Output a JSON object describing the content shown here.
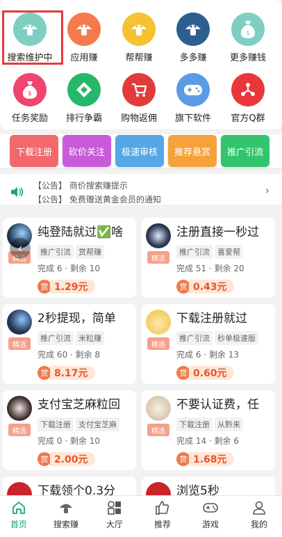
{
  "grid": [
    {
      "label": "搜索维护中",
      "color": "#7ecfc1",
      "icon": "mushroom-icon"
    },
    {
      "label": "应用赚",
      "color": "#f57b4e",
      "icon": "mushroom-icon"
    },
    {
      "label": "帮帮赚",
      "color": "#f6c233",
      "icon": "mushroom-icon"
    },
    {
      "label": "多多赚",
      "color": "#2e5e8f",
      "icon": "mushroom-icon"
    },
    {
      "label": "更多赚钱",
      "color": "#7ecfc1",
      "icon": "money-bag-icon"
    },
    {
      "label": "任务奖励",
      "color": "#f0456e",
      "icon": "money-bag-icon"
    },
    {
      "label": "排行争霸",
      "color": "#25b86a",
      "icon": "diamond-icon"
    },
    {
      "label": "购物返佣",
      "color": "#e23b3b",
      "icon": "cart-icon"
    },
    {
      "label": "旗下软件",
      "color": "#5b9be6",
      "icon": "gamepad-icon"
    },
    {
      "label": "官方Q群",
      "color": "#e9363a",
      "icon": "share-icon"
    }
  ],
  "buttons": [
    {
      "label": "下载注册",
      "color": "#f2686b"
    },
    {
      "label": "砍价关注",
      "color": "#c85bd8"
    },
    {
      "label": "极速审核",
      "color": "#55a7e6"
    },
    {
      "label": "推荐悬赏",
      "color": "#f5a23b"
    },
    {
      "label": "推广引流",
      "color": "#33c56b"
    }
  ],
  "notice": {
    "line1": "【公告】 商价搜索赚提示",
    "line2": "【公告】 免费赠送黄金会员的通知"
  },
  "cards": [
    {
      "title": "纯登陆就过✅啥",
      "chips": [
        "推广引流",
        "赏帮赚"
      ],
      "stats": "完成 6 · 剩余 10",
      "reward_badge": "赏",
      "reward": "1.29元",
      "selected": "精选",
      "avatar": "#1b2f4a"
    },
    {
      "title": "注册直接一秒过",
      "chips": [
        "推广引流",
        "喜爱帮"
      ],
      "stats": "完成 51 · 剩余 20",
      "reward_badge": "赏",
      "reward": "0.43元",
      "selected": "精选",
      "avatar": "#2b3550"
    },
    {
      "title": "2秒提现，简单",
      "chips": [
        "推广引流",
        "米粒赚"
      ],
      "stats": "完成 60 · 剩余 8",
      "reward_badge": "赏",
      "reward": "8.17元",
      "selected": "精选",
      "avatar": "#23324f"
    },
    {
      "title": "下载注册就过",
      "chips": [
        "推广引流",
        "秒单极速版"
      ],
      "stats": "完成 6 · 剩余 13",
      "reward_badge": "赏",
      "reward": "0.60元",
      "selected": "精选",
      "avatar": "#f3d06a"
    },
    {
      "title": "支付宝芝麻粒回",
      "chips": [
        "下载注册",
        "支付宝芝麻"
      ],
      "stats": "完成 0 · 剩余 10",
      "reward_badge": "赏",
      "reward": "2.00元",
      "selected": "精选",
      "avatar": "#3a2a2a"
    },
    {
      "title": "不要认证费，任",
      "chips": [
        "下载注册",
        "从黔来"
      ],
      "stats": "完成 14 · 剩余 6",
      "reward_badge": "赏",
      "reward": "1.68元",
      "selected": "精选",
      "avatar": "#d8c7b0"
    },
    {
      "title": "下载领个0.3分",
      "avatar": "#c9242a"
    },
    {
      "title": "浏览5秒",
      "avatar": "#c9242a"
    }
  ],
  "tabs": [
    {
      "label": "首页",
      "icon": "home-icon"
    },
    {
      "label": "搜索赚",
      "icon": "mushroom-icon"
    },
    {
      "label": "大厅",
      "icon": "hall-icon"
    },
    {
      "label": "推荐",
      "icon": "thumb-up-icon"
    },
    {
      "label": "游戏",
      "icon": "gamepad-icon"
    },
    {
      "label": "我的",
      "icon": "user-icon"
    }
  ],
  "active_tab": "首页",
  "accent": "#17a86a"
}
